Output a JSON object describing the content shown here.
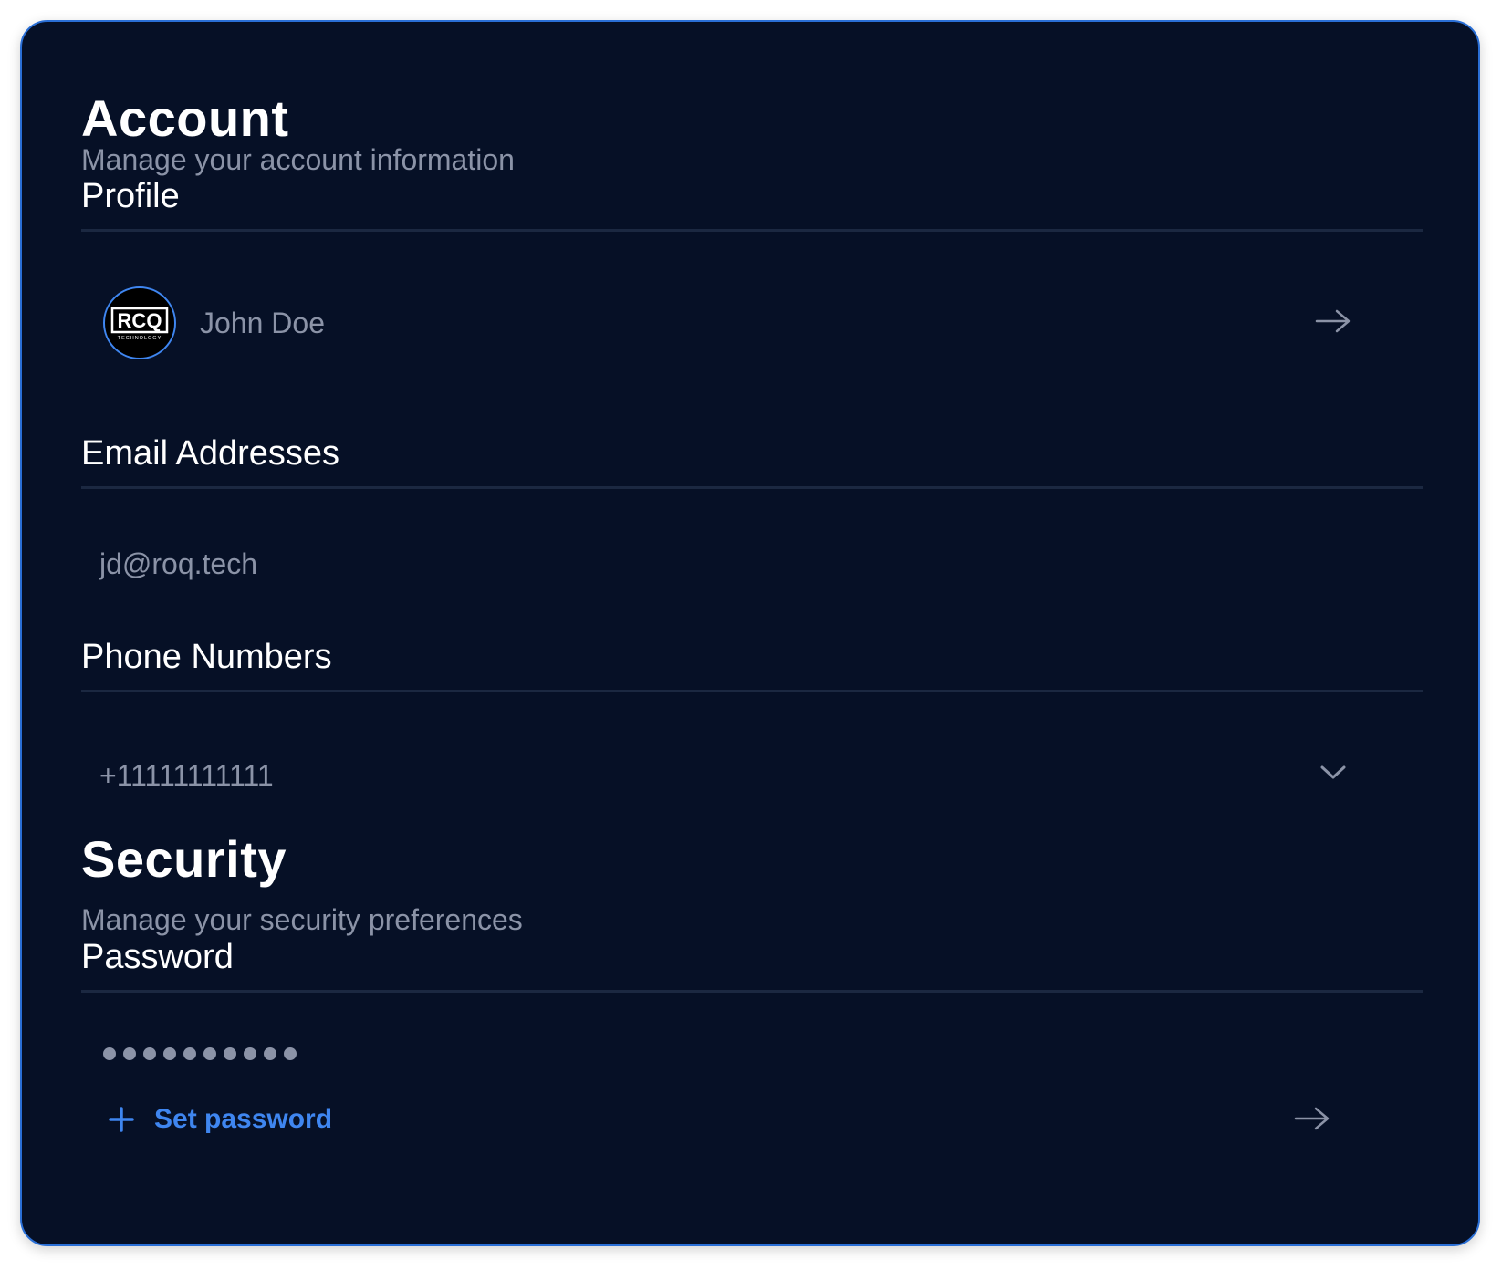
{
  "account": {
    "title": "Account",
    "subtitle": "Manage your account information",
    "profile": {
      "heading": "Profile",
      "name": "John Doe",
      "avatar_logo_text": "RCQ",
      "avatar_logo_subtext": "TECHNOLOGY"
    },
    "email": {
      "heading": "Email Addresses",
      "value": "jd@roq.tech"
    },
    "phone": {
      "heading": "Phone Numbers",
      "value": "+11111111111"
    }
  },
  "security": {
    "title": "Security",
    "subtitle": "Manage your security preferences",
    "password": {
      "heading": "Password",
      "masked_length": 10,
      "set_label": "Set password"
    }
  },
  "icons": {
    "profile_arrow": "arrow-right-icon",
    "phone_toggle": "chevron-down-icon",
    "password_arrow": "arrow-right-icon",
    "set_password": "plus-icon"
  },
  "colors": {
    "card_background": "#061026",
    "card_border": "#2a6fd6",
    "accent": "#3f86f0",
    "muted_text": "#8b93a7",
    "divider": "#1b2841"
  }
}
